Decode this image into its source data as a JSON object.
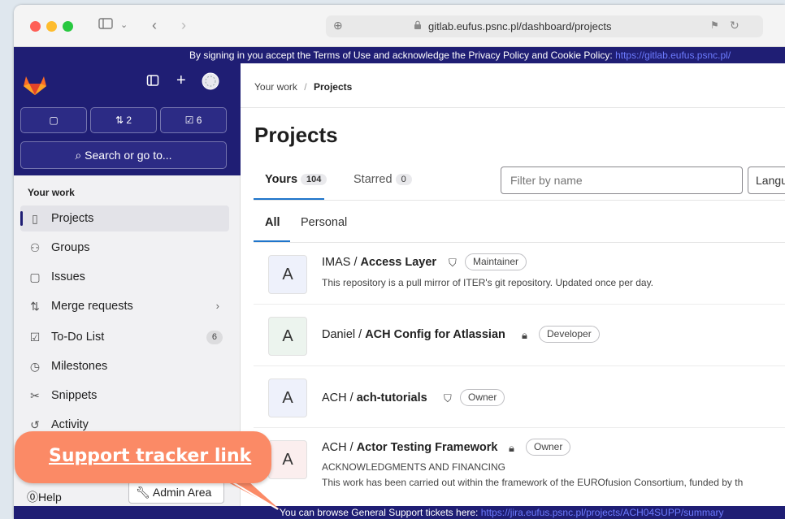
{
  "browser": {
    "url": "gitlab.eufus.psnc.pl/dashboard/projects"
  },
  "banner": {
    "text": "By signing in you accept the Terms of Use and acknowledge the Privacy Policy and Cookie Policy:",
    "link": "https://gitlab.eufus.psnc.pl/"
  },
  "sidebar": {
    "counters": [
      {
        "icon": "issues-icon",
        "count": ""
      },
      {
        "icon": "merge-request-icon",
        "count": "2"
      },
      {
        "icon": "todo-icon",
        "count": "6"
      }
    ],
    "search_label": "Search or go to...",
    "section_title": "Your work",
    "items": [
      {
        "label": "Projects",
        "icon": "project-icon"
      },
      {
        "label": "Groups",
        "icon": "group-icon"
      },
      {
        "label": "Issues",
        "icon": "issues-icon"
      },
      {
        "label": "Merge requests",
        "icon": "merge-request-icon"
      },
      {
        "label": "To-Do List",
        "icon": "todo-icon",
        "badge": "6"
      },
      {
        "label": "Milestones",
        "icon": "milestone-icon"
      },
      {
        "label": "Snippets",
        "icon": "snippet-icon"
      },
      {
        "label": "Activity",
        "icon": "activity-icon"
      }
    ],
    "help_label": "Help",
    "admin_label": "Admin Area"
  },
  "main": {
    "breadcrumb": {
      "parent": "Your work",
      "current": "Projects"
    },
    "title": "Projects",
    "tabs": [
      {
        "label": "Yours",
        "count": "104"
      },
      {
        "label": "Starred",
        "count": "0"
      }
    ],
    "filter_placeholder": "Filter by name",
    "language_select": "Langu",
    "subtabs": [
      "All",
      "Personal"
    ],
    "projects": [
      {
        "avatar": "A",
        "namespace": "IMAS / ",
        "name": "Access Layer",
        "visibility": "shield",
        "role": "Maintainer",
        "desc": "This repository is a pull mirror of ITER's git repository. Updated once per day.",
        "desc2": "",
        "color": "#eef1fb"
      },
      {
        "avatar": "A",
        "namespace": "Daniel / ",
        "name": "ACH Config for Atlassian",
        "visibility": "lock",
        "role": "Developer",
        "desc": "",
        "desc2": "",
        "color": "#ecf4ee"
      },
      {
        "avatar": "A",
        "namespace": "ACH / ",
        "name": "ach-tutorials",
        "visibility": "shield",
        "role": "Owner",
        "desc": "",
        "desc2": "",
        "color": "#eef1fb"
      },
      {
        "avatar": "A",
        "namespace": "ACH / ",
        "name": "Actor Testing Framework",
        "visibility": "lock",
        "role": "Owner",
        "desc": "ACKNOWLEDGMENTS AND FINANCING",
        "desc2": "This work has been carried out within the framework of the EUROfusion Consortium, funded by th",
        "color": "#fbeeee"
      }
    ]
  },
  "footer": {
    "text": "You can browse General Support tickets here:",
    "link": "https://jira.eufus.psnc.pl/projects/ACH04SUPP/summary"
  },
  "callout": {
    "label": "Support tracker link",
    "color": "#fb8a66"
  }
}
